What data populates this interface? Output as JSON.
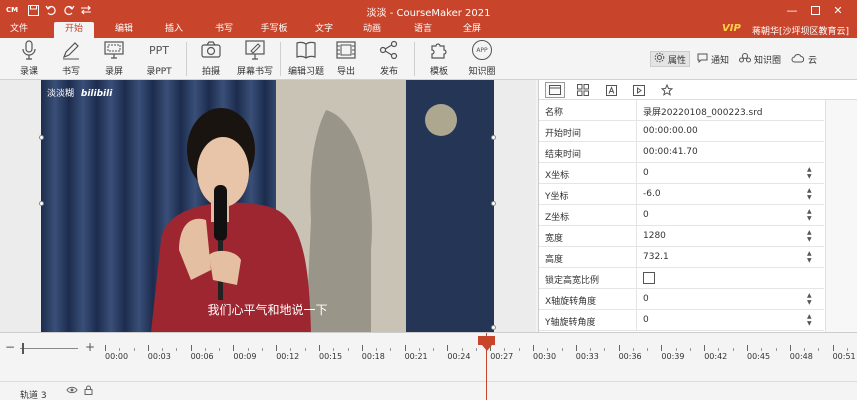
{
  "window": {
    "title": "淡淡 - CourseMaker 2021",
    "app_badge": "CM"
  },
  "menu": {
    "items": [
      "文件",
      "开始",
      "编辑",
      "插入",
      "书写",
      "手写板",
      "文字",
      "动画",
      "语言",
      "全屏"
    ],
    "active": "开始",
    "vip": "VIP",
    "user": "蒋朝华[沙坪坝区教育云]"
  },
  "ribbon": {
    "buttons": [
      {
        "label": "录课",
        "icon": "microphone-icon"
      },
      {
        "label": "书写",
        "icon": "pen-icon"
      },
      {
        "label": "录屏",
        "icon": "screen-record-icon"
      },
      {
        "label": "录PPT",
        "icon": "ppt-icon",
        "icon_text": "PPT"
      },
      {
        "label": "拍摄",
        "icon": "camera-icon"
      },
      {
        "label": "屏幕书写",
        "icon": "screen-write-icon"
      },
      {
        "label": "编辑习题",
        "icon": "book-icon"
      },
      {
        "label": "导出",
        "icon": "export-film-icon"
      },
      {
        "label": "发布",
        "icon": "share-icon"
      },
      {
        "label": "模板",
        "icon": "puzzle-icon"
      },
      {
        "label": "知识圈",
        "icon": "app-icon",
        "icon_text": "APP"
      }
    ],
    "right_buttons": [
      {
        "label": "属性",
        "icon": "gear-icon"
      },
      {
        "label": "通知",
        "icon": "chat-bubble-icon"
      },
      {
        "label": "知识圈",
        "icon": "knowledge-circle-icon"
      },
      {
        "label": "云",
        "icon": "cloud-icon"
      }
    ]
  },
  "video": {
    "logo_text": "淡淡糊",
    "logo_brand": "bilibili",
    "subtitle": "我们心平气和地说一下"
  },
  "properties": {
    "tabs": [
      "layout-tab-icon",
      "grid-tab-icon",
      "text-tab-icon",
      "play-tab-icon",
      "star-tab-icon"
    ],
    "rows": [
      {
        "key": "名称",
        "value": "录屏20220108_000223.srd",
        "spin": false
      },
      {
        "key": "开始时间",
        "value": "00:00:00.00",
        "spin": false
      },
      {
        "key": "结束时间",
        "value": "00:00:41.70",
        "spin": false
      },
      {
        "key": "X坐标",
        "value": "0",
        "spin": true
      },
      {
        "key": "Y坐标",
        "value": "-6.0",
        "spin": true
      },
      {
        "key": "Z坐标",
        "value": "0",
        "spin": true
      },
      {
        "key": "宽度",
        "value": "1280",
        "spin": true
      },
      {
        "key": "高度",
        "value": "732.1",
        "spin": true
      },
      {
        "key": "锁定高宽比例",
        "value": "",
        "checkbox": true,
        "checked": false
      },
      {
        "key": "X轴旋转角度",
        "value": "0",
        "spin": true
      },
      {
        "key": "Y轴旋转角度",
        "value": "0",
        "spin": true
      }
    ]
  },
  "timeline": {
    "zoom_minus": "−",
    "zoom_plus": "+",
    "labels": [
      "00:00",
      "00:03",
      "00:06",
      "00:09",
      "00:12",
      "00:15",
      "00:18",
      "00:21",
      "00:24",
      "00:27",
      "00:30",
      "00:33",
      "00:36",
      "00:39",
      "00:42",
      "00:45",
      "00:48",
      "00:51"
    ],
    "track_name": "轨道 3",
    "playhead_time_seconds": 25.5
  }
}
